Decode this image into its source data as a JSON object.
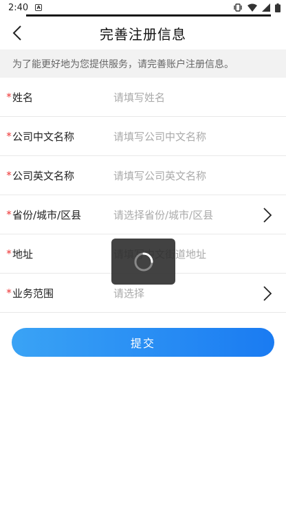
{
  "status_bar": {
    "time": "2:40",
    "notification_icon": "a-box-icon",
    "icons": [
      "vibrate-icon",
      "wifi-icon",
      "signal-icon",
      "battery-icon"
    ]
  },
  "header": {
    "title": "完善注册信息",
    "back_icon": "chevron-left-icon"
  },
  "notice": "为了能更好地为您提供服务，请完善账户注册信息。",
  "form": {
    "required_mark": "*",
    "fields": [
      {
        "label": "姓名",
        "placeholder": "请填写姓名",
        "has_arrow": false
      },
      {
        "label": "公司中文名称",
        "placeholder": "请填写公司中文名称",
        "has_arrow": false
      },
      {
        "label": "公司英文名称",
        "placeholder": "请填写公司英文名称",
        "has_arrow": false
      },
      {
        "label": "省份/城市/区县",
        "placeholder": "请选择省份/城市/区县",
        "has_arrow": true
      },
      {
        "label": "地址",
        "placeholder": "请填写中文街道地址",
        "has_arrow": false
      },
      {
        "label": "业务范围",
        "placeholder": "请选择",
        "has_arrow": true
      }
    ]
  },
  "submit_label": "提交",
  "colors": {
    "accent_start": "#3aa3f5",
    "accent_end": "#1a7bf2",
    "required": "#e33333",
    "notice_bg": "#f2f2f2"
  }
}
